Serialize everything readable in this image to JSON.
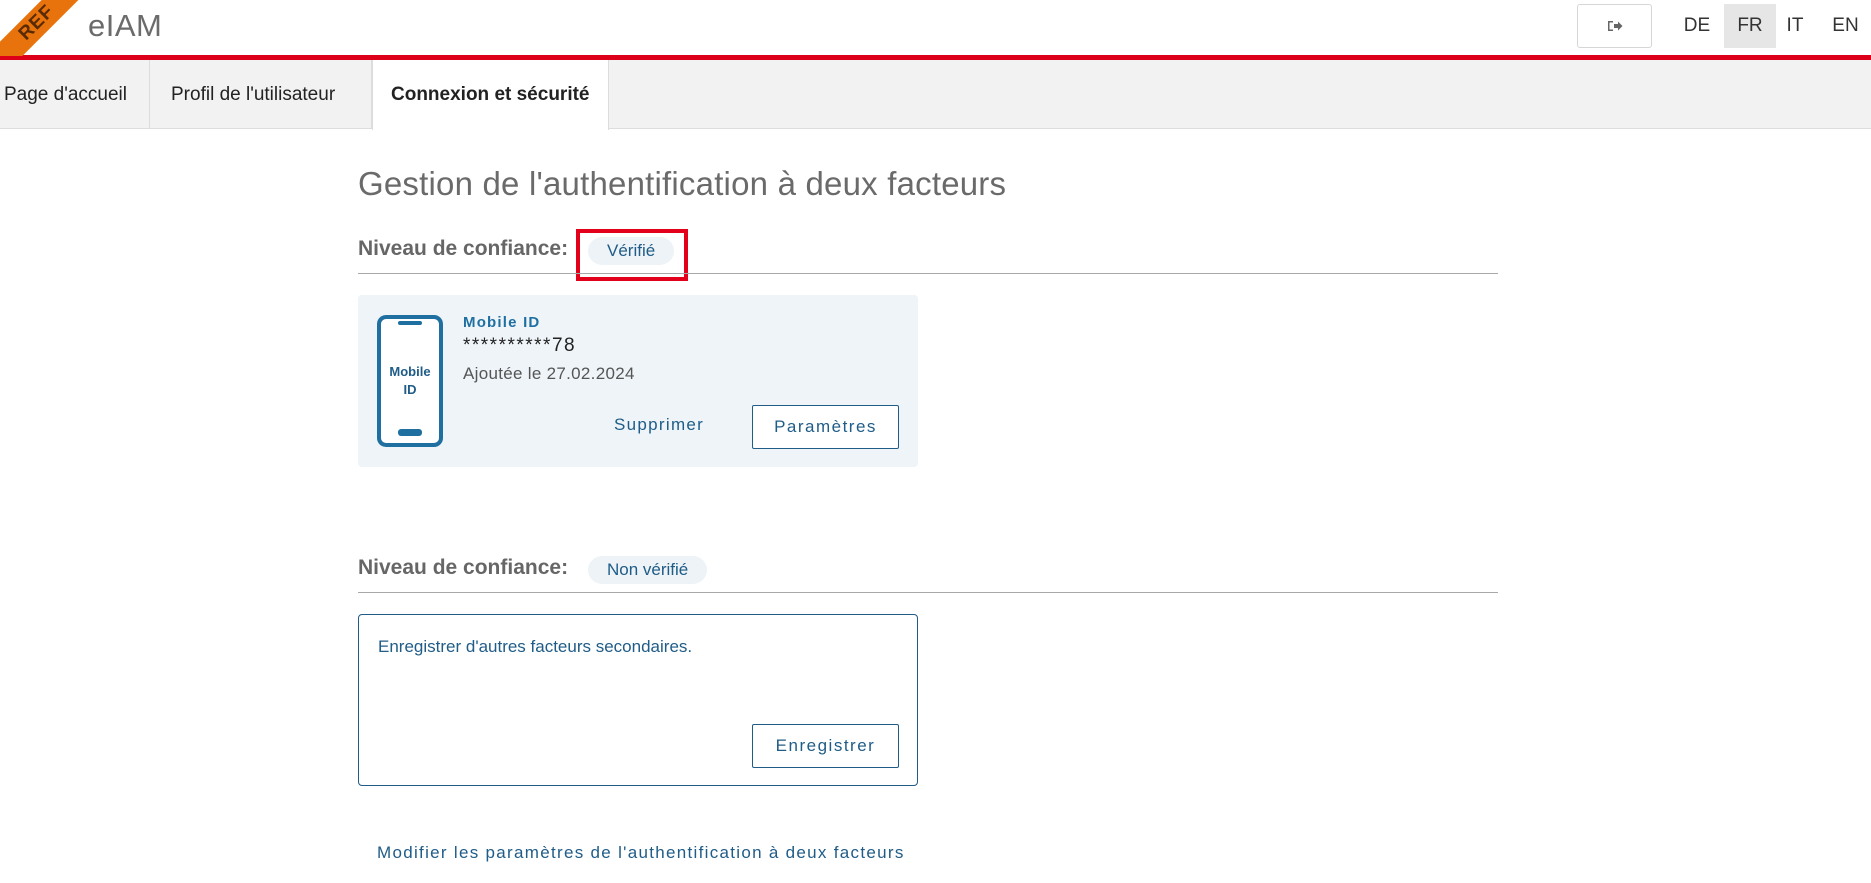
{
  "header": {
    "ribbon_label": "REF",
    "brand": "eIAM",
    "logout_icon": "sign-out-icon",
    "languages": [
      {
        "code": "DE",
        "active": false
      },
      {
        "code": "FR",
        "active": true
      },
      {
        "code": "IT",
        "active": false
      },
      {
        "code": "EN",
        "active": false
      }
    ]
  },
  "tabs": [
    {
      "label": "Page d'accueil",
      "active": false
    },
    {
      "label": "Profil de l'utilisateur",
      "active": false
    },
    {
      "label": "Connexion et sécurité",
      "active": true
    }
  ],
  "main": {
    "title": "Gestion de l'authentification à deux facteurs",
    "verified_section": {
      "level_label": "Niveau de confiance:",
      "level_badge": "Vérifié",
      "factor": {
        "icon_text_line1": "Mobile",
        "icon_text_line2": "ID",
        "name": "Mobile ID",
        "number": "**********78",
        "added": "Ajoutée le 27.02.2024",
        "delete_label": "Supprimer",
        "settings_label": "Paramètres"
      }
    },
    "unverified_section": {
      "level_label": "Niveau de confiance:",
      "level_badge": "Non vérifié",
      "register_text": "Enregistrer d'autres facteurs secondaires.",
      "register_label": "Enregistrer"
    },
    "modify_link": "Modifier les paramètres de l'authentification à deux facteurs"
  },
  "colors": {
    "accent_red": "#dc0018",
    "ribbon_orange": "#e8730c",
    "link_blue": "#1f5c87",
    "card_bg": "#eef4f8"
  }
}
